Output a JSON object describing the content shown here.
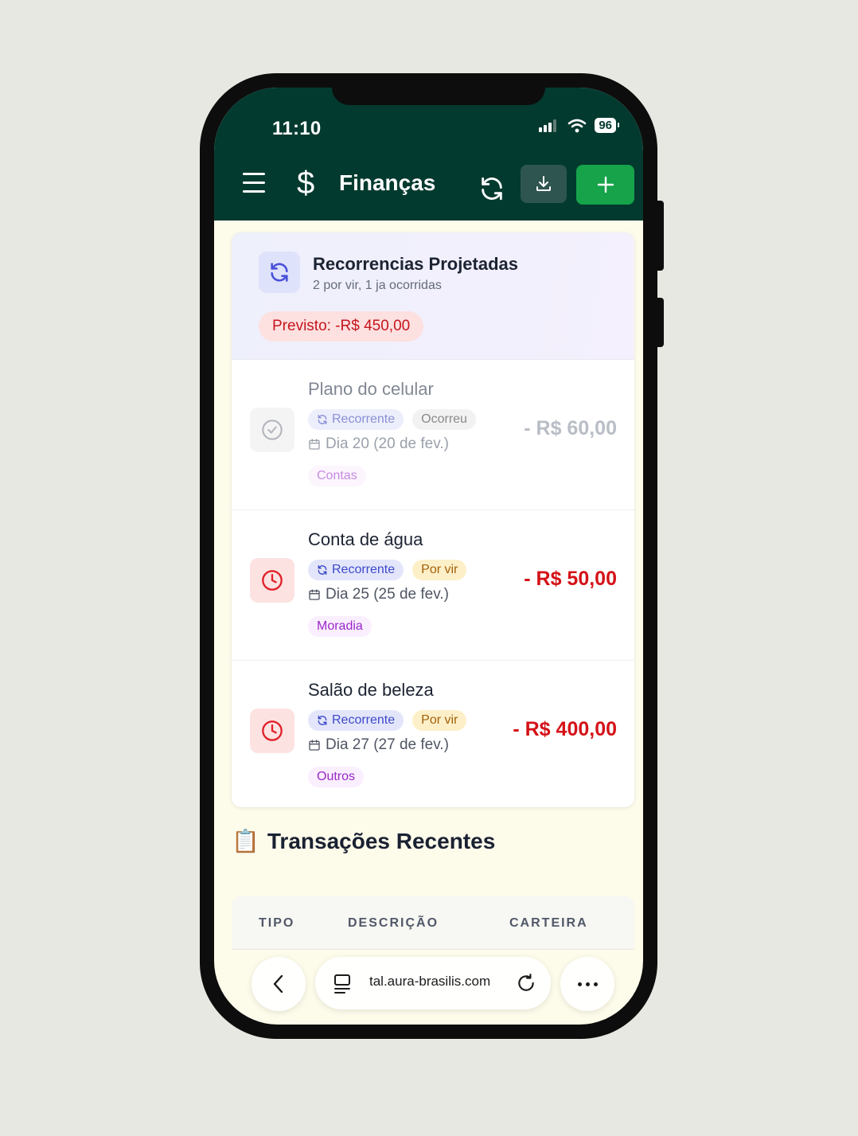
{
  "status": {
    "time": "11:10",
    "battery": "96"
  },
  "header": {
    "title": "Finanças"
  },
  "projected": {
    "title": "Recorrencias Projetadas",
    "subtitle": "2 por vir, 1 ja ocorridas",
    "forecast": "Previsto: -R$ 450,00"
  },
  "items": [
    {
      "title": "Plano do celular",
      "recurring": "Recorrente",
      "status": "Ocorreu",
      "date": "Dia 20 (20 de fev.)",
      "category": "Contas",
      "amount": "- R$ 60,00"
    },
    {
      "title": "Conta de água",
      "recurring": "Recorrente",
      "status": "Por vir",
      "date": "Dia 25 (25 de fev.)",
      "category": "Moradia",
      "amount": "- R$ 50,00"
    },
    {
      "title": "Salão de beleza",
      "recurring": "Recorrente",
      "status": "Por vir",
      "date": "Dia 27 (27 de fev.)",
      "category": "Outros",
      "amount": "- R$ 400,00"
    }
  ],
  "recent": {
    "icon": "📋",
    "title": "Transações Recentes",
    "columns": [
      "TIPO",
      "DESCRIÇÃO",
      "CARTEIRA"
    ]
  },
  "browser": {
    "url": "tal.aura-brasilis.com"
  },
  "colors": {
    "header_bg": "#033a2f",
    "add_button": "#16a34a",
    "negative": "#d41218"
  }
}
